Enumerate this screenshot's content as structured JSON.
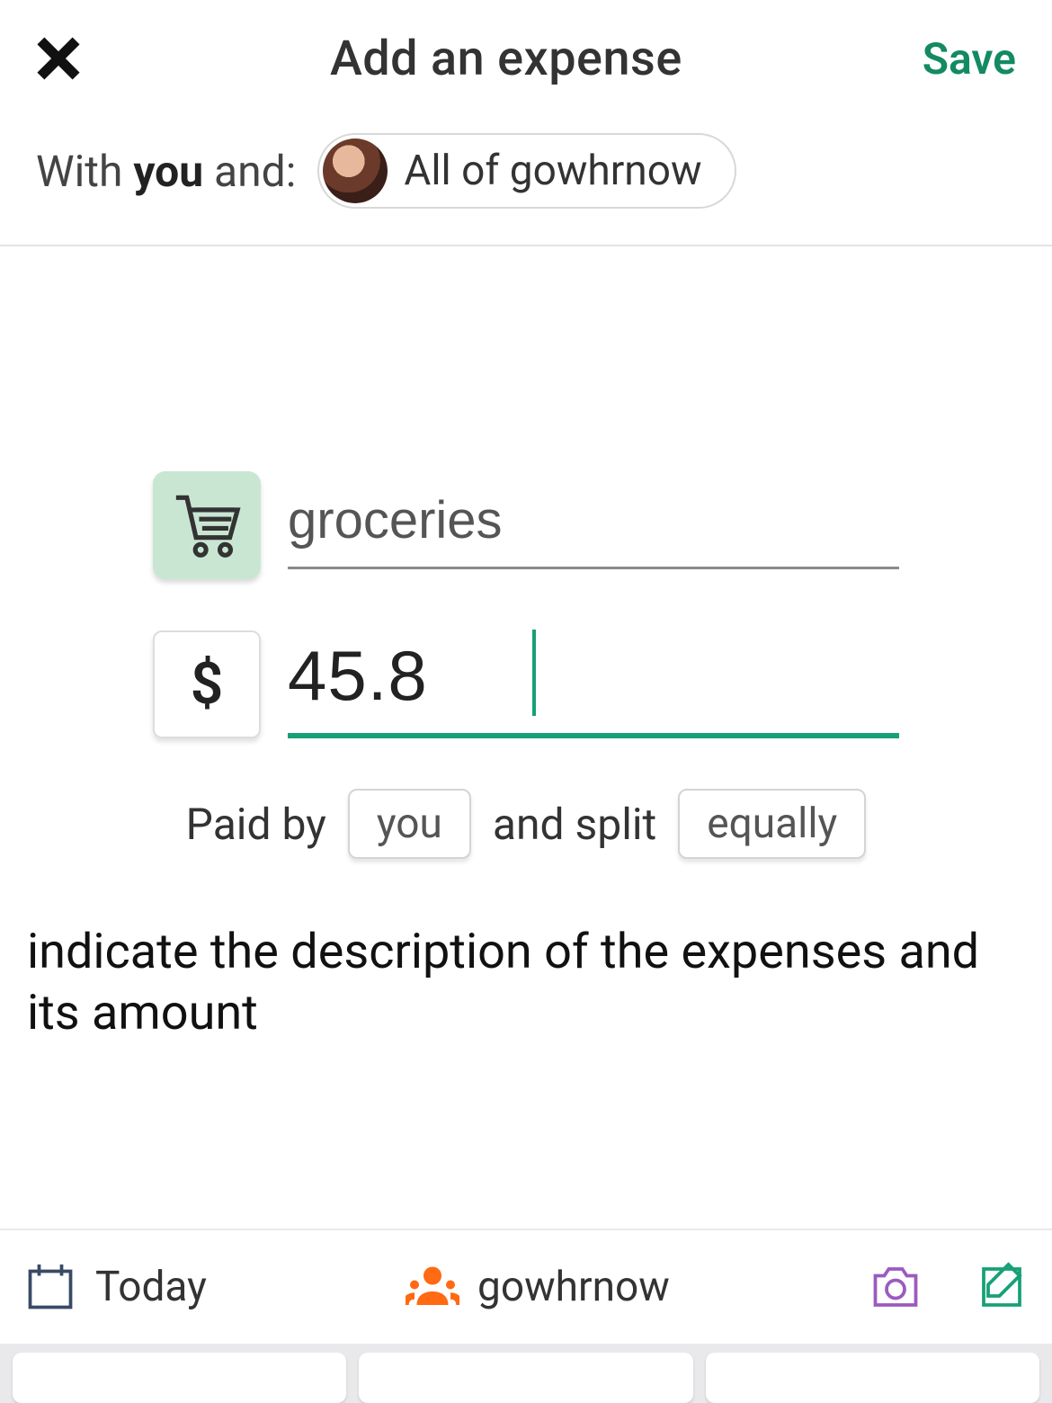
{
  "header": {
    "title": "Add an expense",
    "save_label": "Save"
  },
  "with": {
    "prefix": "With ",
    "you": "you",
    "suffix": " and:",
    "chip_label": "All of gowhrnow"
  },
  "expense": {
    "category_icon": "shopping-cart",
    "description": "groceries",
    "currency_symbol": "$",
    "amount": "45.8"
  },
  "split": {
    "paid_by_label": "Paid by",
    "payer": "you",
    "and_split_label": "and split",
    "method": "equally"
  },
  "instruction_text": "indicate the description of the expenses and its amount",
  "bottom": {
    "date_label": "Today",
    "group_label": "gowhrnow"
  },
  "colors": {
    "accent": "#17a077",
    "category_bg": "#c9e6d3",
    "save_text": "#138a63"
  }
}
